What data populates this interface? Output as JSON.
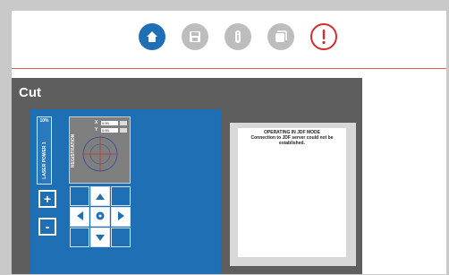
{
  "toolbar": {
    "icons": [
      "home-icon",
      "save-icon",
      "info-icon",
      "copy-icon",
      "alert-icon"
    ],
    "colors": {
      "active": "#1f6fb5",
      "disabled": "#bdbdbd",
      "alert": "#d82c2c"
    }
  },
  "panel": {
    "title": "Cut",
    "laser_power": {
      "label": "LASER POWER 1",
      "percent": "10%"
    },
    "registration": {
      "label": "REGISTRATION",
      "x_label": "X",
      "x_value": "0.00",
      "y_label": "Y",
      "y_value": "0.00"
    },
    "buttons": {
      "plus": "+",
      "minus": "-"
    },
    "status": {
      "title": "OPERATING IN JDF MODE",
      "message": "Connection to JDF server could not be established."
    }
  }
}
